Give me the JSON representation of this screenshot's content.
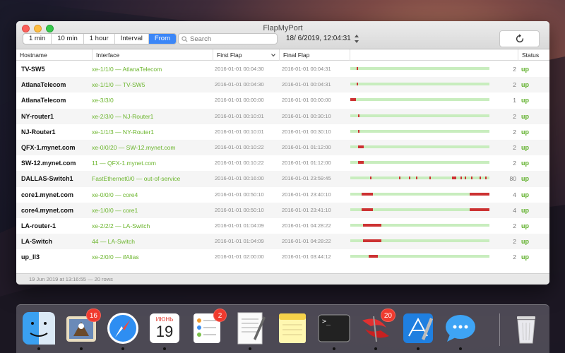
{
  "window": {
    "title": "FlapMyPort"
  },
  "toolbar": {
    "segments": [
      "1 min",
      "10 min",
      "1 hour",
      "Interval",
      "From"
    ],
    "active_segment": "From",
    "search_placeholder": "Search",
    "search_value": "",
    "date_value": "18/  6/2019, 12:04:31"
  },
  "table": {
    "columns": [
      "Hostname",
      "Interface",
      "First Flap",
      "Final Flap",
      "",
      "Status"
    ],
    "sorted_column": "First Flap",
    "rows": [
      {
        "host": "TV-SW5",
        "iface": "xe-1/1/0 — AtlanaTelecom",
        "first": "2016-01-01 00:04:30",
        "final": "2016-01-01 00:04:31",
        "count": "2",
        "status": "up",
        "flaps": [
          [
            0.045,
            0.005
          ]
        ]
      },
      {
        "host": "AtlanaTelecom",
        "iface": "xe-1/1/0 — TV-SW5",
        "first": "2016-01-01 00:04:30",
        "final": "2016-01-01 00:04:31",
        "count": "2",
        "status": "up",
        "flaps": [
          [
            0.045,
            0.005
          ]
        ]
      },
      {
        "host": "AtlanaTelecom",
        "iface": "xe-3/3/0",
        "first": "2016-01-01 00:00:00",
        "final": "2016-01-01 00:00:00",
        "count": "1",
        "status": "up",
        "flaps": [
          [
            0.0,
            0.04
          ]
        ]
      },
      {
        "host": "NY-router1",
        "iface": "xe-2/3/0 — NJ-Router1",
        "first": "2016-01-01 00:10:01",
        "final": "2016-01-01 00:30:10",
        "count": "2",
        "status": "up",
        "flaps": [
          [
            0.055,
            0.01
          ]
        ]
      },
      {
        "host": "NJ-Router1",
        "iface": "xe-1/1/3 — NY-Router1",
        "first": "2016-01-01 00:10:01",
        "final": "2016-01-01 00:30:10",
        "count": "2",
        "status": "up",
        "flaps": [
          [
            0.055,
            0.01
          ]
        ]
      },
      {
        "host": "QFX-1.mynet.com",
        "iface": "xe-0/0/20 — SW-12.mynet.com",
        "first": "2016-01-01 00:10:22",
        "final": "2016-01-01 01:12:00",
        "count": "2",
        "status": "up",
        "flaps": [
          [
            0.055,
            0.04
          ]
        ]
      },
      {
        "host": "SW-12.mynet.com",
        "iface": "11 — QFX-1.mynet.com",
        "first": "2016-01-01 00:10:22",
        "final": "2016-01-01 01:12:00",
        "count": "2",
        "status": "up",
        "flaps": [
          [
            0.055,
            0.04
          ]
        ]
      },
      {
        "host": "DALLAS-Switch1",
        "iface": "FastEthernet0/0 — out-of-service",
        "first": "2016-01-01 00:16:00",
        "final": "2016-01-01 23:59:45",
        "count": "80",
        "status": "up",
        "flaps": [
          [
            0.14,
            0.006
          ],
          [
            0.35,
            0.006
          ],
          [
            0.42,
            0.006
          ],
          [
            0.47,
            0.006
          ],
          [
            0.57,
            0.006
          ],
          [
            0.73,
            0.03
          ],
          [
            0.79,
            0.006
          ],
          [
            0.82,
            0.006
          ],
          [
            0.87,
            0.006
          ],
          [
            0.93,
            0.006
          ],
          [
            0.97,
            0.006
          ]
        ]
      },
      {
        "host": "core1.mynet.com",
        "iface": "xe-0/0/0 — core4",
        "first": "2016-01-01 00:50:10",
        "final": "2016-01-01 23:40:10",
        "count": "4",
        "status": "up",
        "flaps": [
          [
            0.08,
            0.085
          ],
          [
            0.86,
            0.14
          ]
        ]
      },
      {
        "host": "core4.mynet.com",
        "iface": "xe-1/0/0 — core1",
        "first": "2016-01-01 00:50:10",
        "final": "2016-01-01 23:41:10",
        "count": "4",
        "status": "up",
        "flaps": [
          [
            0.08,
            0.085
          ],
          [
            0.86,
            0.14
          ]
        ]
      },
      {
        "host": "LA-router-1",
        "iface": "xe-2/2/2 — LA-Switch",
        "first": "2016-01-01 01:04:09",
        "final": "2016-01-01 04:28:22",
        "count": "2",
        "status": "up",
        "flaps": [
          [
            0.09,
            0.135
          ]
        ]
      },
      {
        "host": "LA-Switch",
        "iface": "44 — LA-Switch",
        "first": "2016-01-01 01:04:09",
        "final": "2016-01-01 04:28:22",
        "count": "2",
        "status": "up",
        "flaps": [
          [
            0.09,
            0.135
          ]
        ]
      },
      {
        "host": "up_ll3",
        "iface": "xe-2/0/0 — ifAlias",
        "first": "2016-01-01 02:00:00",
        "final": "2016-01-01 03:44:12",
        "count": "2",
        "status": "up",
        "flaps": [
          [
            0.13,
            0.07
          ]
        ]
      }
    ]
  },
  "footer": {
    "text": "19 Jun 2019 at 13:16:55 — 20 rows"
  },
  "dock": {
    "items": [
      {
        "name": "finder",
        "badge": "",
        "running": true
      },
      {
        "name": "mail",
        "badge": "16",
        "running": true
      },
      {
        "name": "safari",
        "badge": "",
        "running": true
      },
      {
        "name": "calendar",
        "badge": "",
        "running": true,
        "month": "ИЮНЬ",
        "day": "19"
      },
      {
        "name": "reminders",
        "badge": "2",
        "running": false
      },
      {
        "name": "textedit",
        "badge": "",
        "running": true
      },
      {
        "name": "notes",
        "badge": "",
        "running": false
      },
      {
        "name": "terminal",
        "badge": "",
        "running": true,
        "prompt": ">_"
      },
      {
        "name": "flapmyport",
        "badge": "20",
        "running": true
      },
      {
        "name": "xcode",
        "badge": "",
        "running": true
      },
      {
        "name": "messages",
        "badge": "",
        "running": true
      },
      {
        "name": "trash",
        "badge": "",
        "running": false
      }
    ]
  },
  "colors": {
    "accent": "#3b86f7",
    "flap": "#cc3232",
    "bar_bg": "#c8edbe",
    "status_up": "#5fb02a",
    "iface": "#6bb52c"
  }
}
